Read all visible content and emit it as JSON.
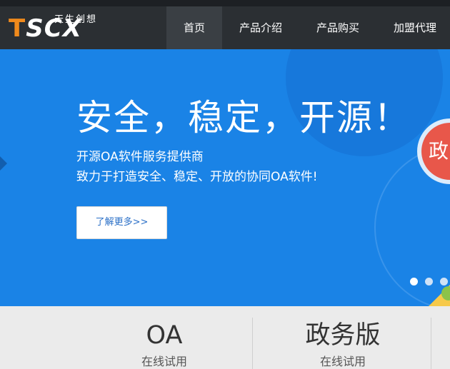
{
  "header": {
    "logo": {
      "brand_first": "T",
      "brand_rest": "SCX",
      "tagline": "天生创想"
    },
    "nav": [
      {
        "label": "首页",
        "active": true
      },
      {
        "label": "产品介绍",
        "active": false
      },
      {
        "label": "产品购买",
        "active": false
      },
      {
        "label": "加盟代理",
        "active": false
      }
    ]
  },
  "hero": {
    "title": "安全，稳定，开源！",
    "subtitle_1": "开源OA软件服务提供商",
    "subtitle_2": "致力于打造安全、稳定、开放的协同OA软件!",
    "more_label": "了解更多>>",
    "badge_text": "政",
    "carousel": {
      "total": 3,
      "active_index": 0
    },
    "colors": {
      "background": "#1a83e6",
      "badge": "#e8574a"
    }
  },
  "products": [
    {
      "name": "OA",
      "sub": "在线试用"
    },
    {
      "name": "政务版",
      "sub": "在线试用"
    }
  ]
}
